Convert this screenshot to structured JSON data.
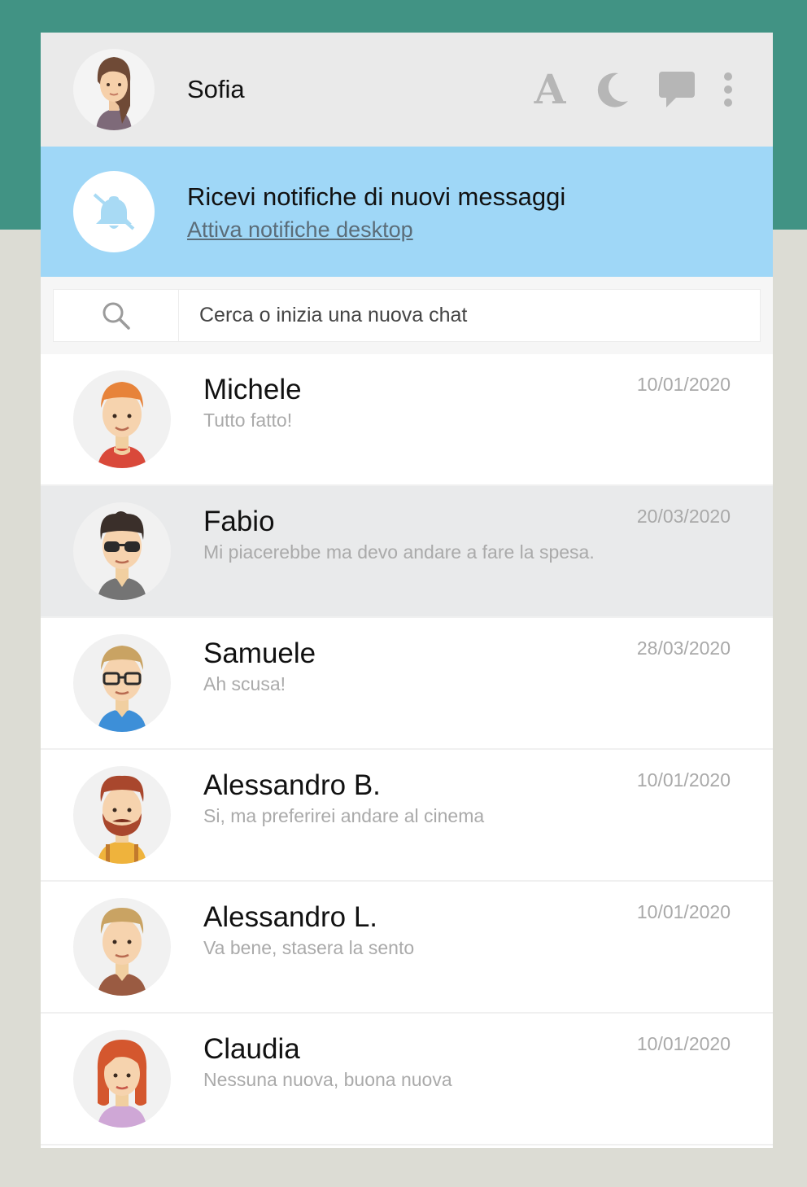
{
  "header": {
    "user_name": "Sofia",
    "icons": [
      "font-size-icon",
      "moon-icon",
      "chat-icon",
      "more-vert-icon"
    ],
    "font_icon_glyph": "A"
  },
  "notification": {
    "title": "Ricevi notifiche di nuovi messaggi",
    "link": "Attiva notifiche desktop",
    "icon": "bell-off-icon"
  },
  "search": {
    "placeholder": "Cerca o inizia una nuova chat",
    "icon": "search-icon"
  },
  "chats": [
    {
      "name": "Michele",
      "preview": "Tutto fatto!",
      "date": "10/01/2020"
    },
    {
      "name": "Fabio",
      "preview": "Mi piacerebbe ma devo andare a fare la spesa.",
      "date": "20/03/2020"
    },
    {
      "name": "Samuele",
      "preview": "Ah scusa!",
      "date": "28/03/2020"
    },
    {
      "name": "Alessandro B.",
      "preview": "Si, ma preferirei andare al cinema",
      "date": "10/01/2020"
    },
    {
      "name": "Alessandro L.",
      "preview": "Va bene, stasera la sento",
      "date": "10/01/2020"
    },
    {
      "name": "Claudia",
      "preview": "Nessuna nuova, buona nuova",
      "date": "10/01/2020"
    }
  ],
  "colors": {
    "top_band": "#419384",
    "background": "#dcdcd4",
    "header": "#eaeaea",
    "notification": "#9fd7f7",
    "active_row": "#e9eaeb"
  }
}
